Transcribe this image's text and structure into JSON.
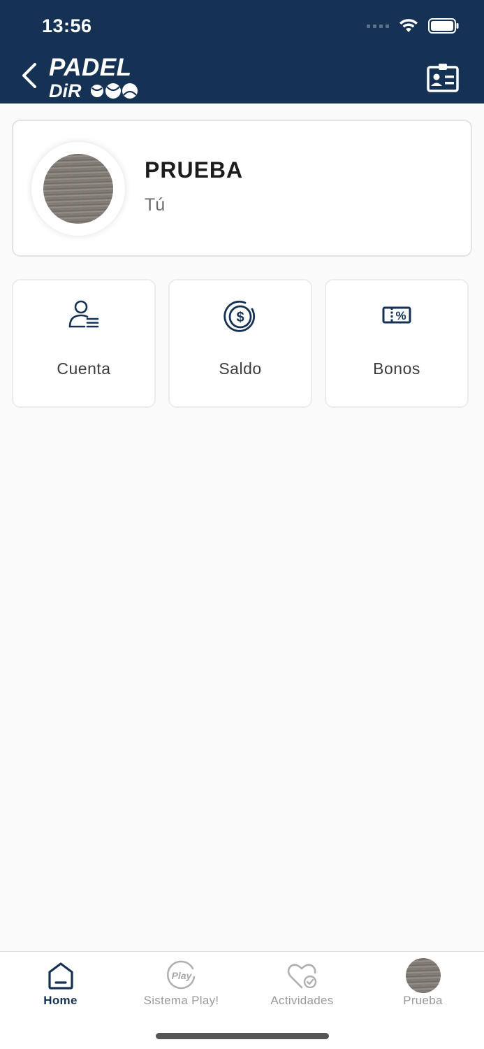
{
  "status_bar": {
    "time": "13:56"
  },
  "navbar": {
    "logo_line1": "PADEL",
    "logo_line2": "DiR",
    "back_icon": "chevron-left-icon",
    "profile_card_icon": "id-card-icon"
  },
  "profile": {
    "name": "PRUEBA",
    "subtitle": "Tú"
  },
  "tiles": [
    {
      "label": "Cuenta",
      "icon": "user-list-icon"
    },
    {
      "label": "Saldo",
      "icon": "dollar-coin-icon"
    },
    {
      "label": "Bonos",
      "icon": "discount-ticket-icon"
    }
  ],
  "tabbar": {
    "items": [
      {
        "label": "Home",
        "icon": "home-icon",
        "active": true
      },
      {
        "label": "Sistema Play!",
        "icon": "play-badge-icon",
        "active": false
      },
      {
        "label": "Actividades",
        "icon": "heart-check-icon",
        "active": false
      },
      {
        "label": "Prueba",
        "icon": "avatar",
        "active": false
      }
    ]
  },
  "colors": {
    "brand_navy": "#153255",
    "background": "#fafafa",
    "inactive_tab": "#9a9a9a"
  }
}
